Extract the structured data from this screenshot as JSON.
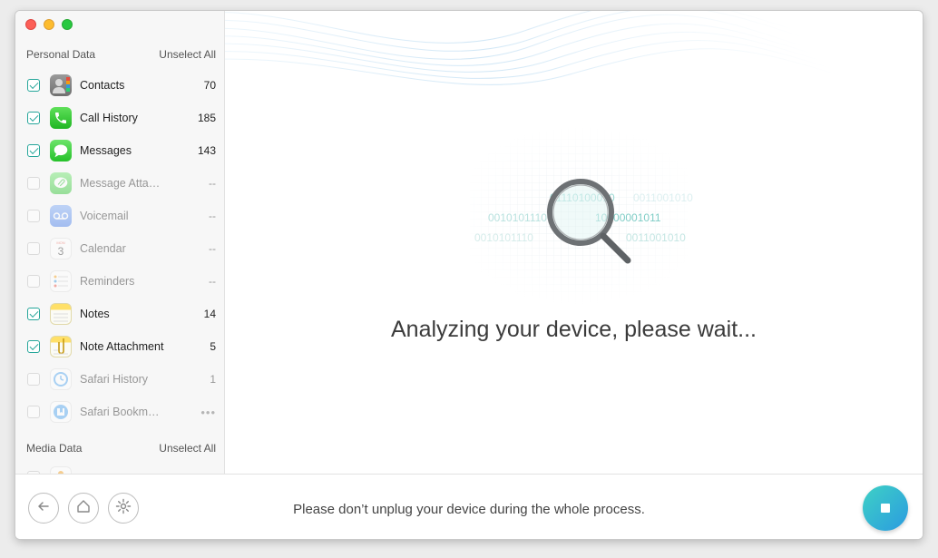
{
  "sidebar": {
    "personal": {
      "title": "Personal Data",
      "unselect": "Unselect All",
      "items": [
        {
          "label": "Contacts",
          "count": "70",
          "checked": true,
          "icon": "contacts-icon"
        },
        {
          "label": "Call History",
          "count": "185",
          "checked": true,
          "icon": "phone-icon"
        },
        {
          "label": "Messages",
          "count": "143",
          "checked": true,
          "icon": "messages-icon"
        },
        {
          "label": "Message Atta…",
          "count": "--",
          "checked": false,
          "icon": "message-attachment-icon"
        },
        {
          "label": "Voicemail",
          "count": "--",
          "checked": false,
          "icon": "voicemail-icon"
        },
        {
          "label": "Calendar",
          "count": "--",
          "checked": false,
          "icon": "calendar-icon"
        },
        {
          "label": "Reminders",
          "count": "--",
          "checked": false,
          "icon": "reminders-icon"
        },
        {
          "label": "Notes",
          "count": "14",
          "checked": true,
          "icon": "notes-icon"
        },
        {
          "label": "Note Attachment",
          "count": "5",
          "checked": true,
          "icon": "note-attachment-icon"
        },
        {
          "label": "Safari History",
          "count": "1",
          "checked": false,
          "icon": "safari-history-icon"
        },
        {
          "label": "Safari Bookm…",
          "count": "•••",
          "checked": false,
          "icon": "safari-bookmark-icon"
        }
      ]
    },
    "media": {
      "title": "Media Data",
      "unselect": "Unselect All"
    }
  },
  "main": {
    "status": "Analyzing your device, please wait...",
    "binary": [
      "01110100010",
      "0010101110",
      "10000001011",
      "0010101110",
      "0011001010",
      "0011001010",
      "0011001010"
    ]
  },
  "footer": {
    "notice": "Please don’t unplug your device during the whole process."
  },
  "colors": {
    "accent": "#26a69a",
    "stop_gradient_start": "#3ed1c5",
    "stop_gradient_end": "#2b9be0"
  }
}
